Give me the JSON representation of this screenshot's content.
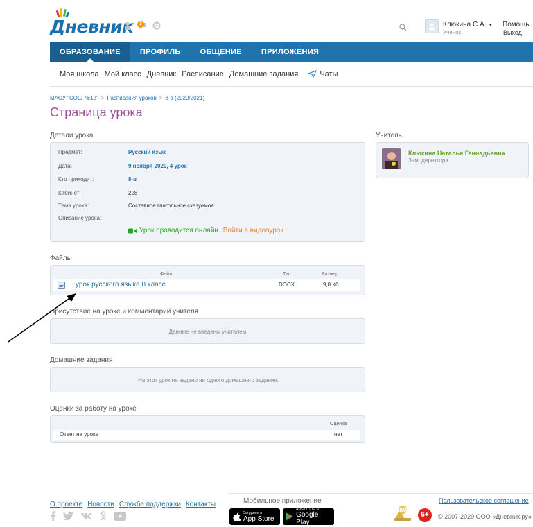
{
  "header": {
    "logo_text": "Дневник",
    "notification_count": "3",
    "user_name": "Клюкина С.А.",
    "user_role": "Ученик",
    "help_label": "Помощь",
    "logout_label": "Выход"
  },
  "main_nav": {
    "tabs": [
      {
        "label": "ОБРАЗОВАНИЕ",
        "active": true
      },
      {
        "label": "ПРОФИЛЬ",
        "active": false
      },
      {
        "label": "ОБЩЕНИЕ",
        "active": false
      },
      {
        "label": "ПРИЛОЖЕНИЯ",
        "active": false
      }
    ]
  },
  "sub_nav": {
    "items": [
      "Моя школа",
      "Мой класс",
      "Дневник",
      "Расписание",
      "Домашние задания",
      "Чаты"
    ]
  },
  "breadcrumb": {
    "items": [
      "МАОУ \"СОШ №12\"",
      "Расписания уроков",
      "8-в (2020/2021)"
    ],
    "separator": ">"
  },
  "page": {
    "title": "Страница урока"
  },
  "lesson_details": {
    "title": "Детали урока",
    "rows": [
      {
        "label": "Предмет:",
        "value": "Русский язык"
      },
      {
        "label": "Дата:",
        "value": "9 ноября 2020, 4 урок"
      },
      {
        "label": "Кто приходит:",
        "value": "8-в"
      },
      {
        "label": "Кабинет:",
        "value": "228"
      },
      {
        "label": "Тема урока:",
        "value": "Составное глагольное сказуемое."
      },
      {
        "label": "Описание урока:",
        "value": ""
      }
    ],
    "online_text": "Урок проводится онлайн.",
    "online_link": "Войти в видеоурок"
  },
  "teacher": {
    "title": "Учитель",
    "name": "Клюкина Наталья Геннадьевна",
    "role": "Зам. директора"
  },
  "files": {
    "title": "Файлы",
    "col_file": "Файл",
    "col_type": "Тип",
    "col_size": "Размер",
    "rows": [
      {
        "name": "урок русского языка 8 класс",
        "type": "DOCX",
        "size": "9,8 Кб"
      }
    ]
  },
  "attendance": {
    "title": "Присутствие на уроке и комментарий учителя",
    "message": "Данные не введены учителем."
  },
  "homework": {
    "title": "Домашние задания",
    "message": "На этот урок не задано ни одного домашнего задания."
  },
  "grades": {
    "title": "Оценки за работу на уроке",
    "col_grade": "Оценка",
    "rows": [
      {
        "label": "Ответ на уроке",
        "grade": "нет"
      }
    ]
  },
  "footer": {
    "links": [
      "О проекте",
      "Новости",
      "Служба поддержки",
      "Контакты"
    ],
    "mobile_title": "Мобильное приложение",
    "appstore_small": "Загрузите в",
    "appstore_big": "App Store",
    "gplay_small": "ДОСТУПНО В",
    "gplay_big": "Google Play",
    "legal_link": "Пользовательское соглашение",
    "age": "6+",
    "copyright": "© 2007-2020 ООО «Дневник.ру»"
  },
  "colors": {
    "nav_blue": "#1f74ae",
    "title_purple": "#9b4f96",
    "online_green": "#2ca02c",
    "link_orange": "#e8843c",
    "teacher_green": "#6aa232"
  }
}
